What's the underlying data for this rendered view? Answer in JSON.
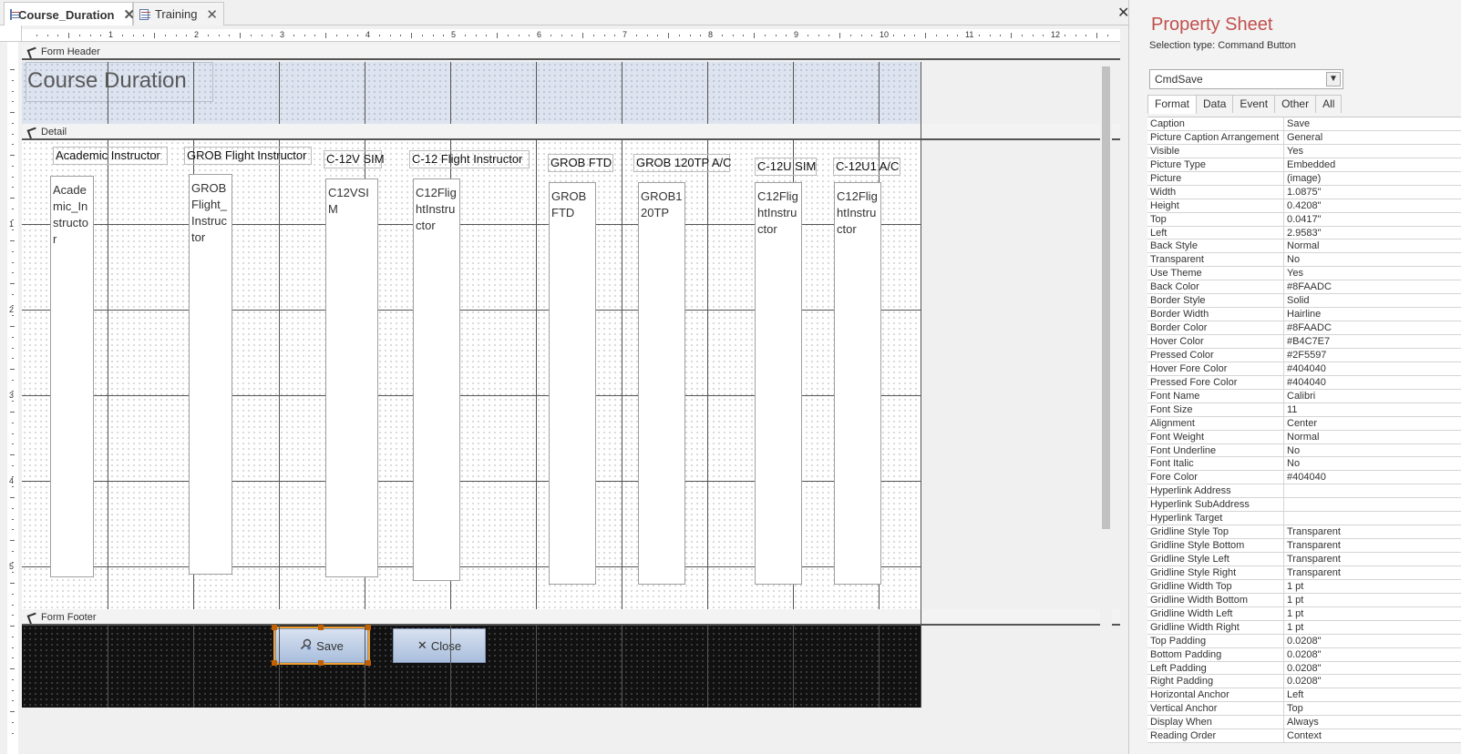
{
  "tabs": [
    {
      "label": "Course_Duration",
      "active": true
    },
    {
      "label": "Training",
      "active": false
    }
  ],
  "rulers": {
    "horizontal": [
      "1",
      "2",
      "3",
      "4",
      "5",
      "6",
      "7",
      "8",
      "9",
      "10",
      "11",
      "12"
    ],
    "vertical": [
      "1",
      "2",
      "3",
      "4",
      "5"
    ]
  },
  "sections": {
    "header": "Form Header",
    "detail": "Detail",
    "footer": "Form Footer"
  },
  "form_title": "Course Duration",
  "detail_labels": [
    "Academic Instructor",
    "GROB Flight Instructor",
    "C-12V SIM",
    "C-12 Flight Instructor",
    "GROB FTD",
    "GROB 120TP A/C",
    "C-12U SIM",
    "C-12U1 A/C"
  ],
  "detail_textboxes": [
    "Academic_Instructor",
    "GROBFlight_Instructor",
    "C12VSIM",
    "C12FlightInstructor",
    "GROBFTD",
    "GROB120TP",
    "C12FlightInstructor",
    "C12FlightInstructor"
  ],
  "footer_buttons": {
    "save": "Save",
    "close": "Close"
  },
  "icons": {
    "save": "search-person-icon",
    "close": "x-icon"
  },
  "property_sheet": {
    "title": "Property Sheet",
    "selection_type": "Selection type:  Command Button",
    "selected_object": "CmdSave",
    "tabs": [
      "Format",
      "Data",
      "Event",
      "Other",
      "All"
    ],
    "active_tab": "Format",
    "properties": [
      {
        "name": "Caption",
        "value": "Save"
      },
      {
        "name": "Picture Caption Arrangement",
        "value": "General"
      },
      {
        "name": "Visible",
        "value": "Yes"
      },
      {
        "name": "Picture Type",
        "value": "Embedded"
      },
      {
        "name": "Picture",
        "value": "(image)"
      },
      {
        "name": "Width",
        "value": "1.0875\""
      },
      {
        "name": "Height",
        "value": "0.4208\""
      },
      {
        "name": "Top",
        "value": "0.0417\""
      },
      {
        "name": "Left",
        "value": "2.9583\""
      },
      {
        "name": "Back Style",
        "value": "Normal"
      },
      {
        "name": "Transparent",
        "value": "No"
      },
      {
        "name": "Use Theme",
        "value": "Yes"
      },
      {
        "name": "Back Color",
        "value": "#8FAADC"
      },
      {
        "name": "Border Style",
        "value": "Solid"
      },
      {
        "name": "Border Width",
        "value": "Hairline"
      },
      {
        "name": "Border Color",
        "value": "#8FAADC"
      },
      {
        "name": "Hover Color",
        "value": "#B4C7E7"
      },
      {
        "name": "Pressed Color",
        "value": "#2F5597"
      },
      {
        "name": "Hover Fore Color",
        "value": "#404040"
      },
      {
        "name": "Pressed Fore Color",
        "value": "#404040"
      },
      {
        "name": "Font Name",
        "value": "Calibri"
      },
      {
        "name": "Font Size",
        "value": "11"
      },
      {
        "name": "Alignment",
        "value": "Center"
      },
      {
        "name": "Font Weight",
        "value": "Normal"
      },
      {
        "name": "Font Underline",
        "value": "No"
      },
      {
        "name": "Font Italic",
        "value": "No"
      },
      {
        "name": "Fore Color",
        "value": "#404040"
      },
      {
        "name": "Hyperlink Address",
        "value": ""
      },
      {
        "name": "Hyperlink SubAddress",
        "value": ""
      },
      {
        "name": "Hyperlink Target",
        "value": ""
      },
      {
        "name": "Gridline Style Top",
        "value": "Transparent"
      },
      {
        "name": "Gridline Style Bottom",
        "value": "Transparent"
      },
      {
        "name": "Gridline Style Left",
        "value": "Transparent"
      },
      {
        "name": "Gridline Style Right",
        "value": "Transparent"
      },
      {
        "name": "Gridline Width Top",
        "value": "1 pt"
      },
      {
        "name": "Gridline Width Bottom",
        "value": "1 pt"
      },
      {
        "name": "Gridline Width Left",
        "value": "1 pt"
      },
      {
        "name": "Gridline Width Right",
        "value": "1 pt"
      },
      {
        "name": "Top Padding",
        "value": "0.0208\""
      },
      {
        "name": "Bottom Padding",
        "value": "0.0208\""
      },
      {
        "name": "Left Padding",
        "value": "0.0208\""
      },
      {
        "name": "Right Padding",
        "value": "0.0208\""
      },
      {
        "name": "Horizontal Anchor",
        "value": "Left"
      },
      {
        "name": "Vertical Anchor",
        "value": "Top"
      },
      {
        "name": "Display When",
        "value": "Always"
      },
      {
        "name": "Reading Order",
        "value": "Context"
      }
    ]
  }
}
